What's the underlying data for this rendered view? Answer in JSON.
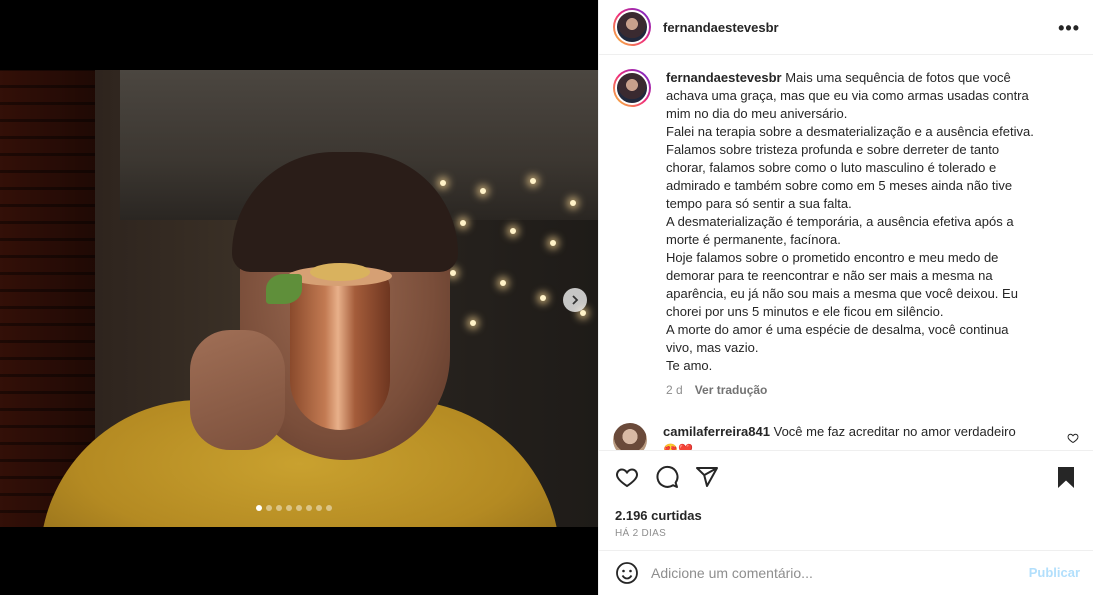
{
  "post": {
    "username": "fernandaestevesbr",
    "more_icon": "ellipsis-icon",
    "carousel": {
      "count": 8,
      "active_index": 0
    }
  },
  "caption": {
    "username": "fernandaestevesbr",
    "lines": [
      "Mais uma sequência de fotos que você achava uma graça, mas que eu via como armas usadas contra mim no dia do meu aniversário.",
      "Falei na terapia sobre a desmaterialização e a ausência efetiva.",
      "Falamos sobre tristeza profunda e sobre derreter de tanto chorar, falamos sobre como o luto masculino é tolerado e admirado e também sobre como em 5 meses ainda não tive tempo para só sentir a sua falta.",
      "A desmaterialização é temporária, a ausência efetiva após a morte é permanente, facínora.",
      "Hoje falamos sobre o prometido encontro e meu medo de demorar para te reencontrar e não ser mais a mesma na aparência, eu já não sou mais a mesma que você deixou. Eu chorei por uns 5 minutos e ele ficou em silêncio.",
      "A morte do amor é uma espécie de desalma, você continua vivo, mas vazio.",
      "Te amo."
    ],
    "time_ago": "2 d",
    "translate": "Ver tradução"
  },
  "comment": {
    "username": "camilaferreira841",
    "text": "Você me faz acreditar no amor verdadeiro",
    "emojis": "😍❤️"
  },
  "actions": {
    "likes": "2.196 curtidas",
    "date": "HÁ 2 DIAS"
  },
  "add_comment": {
    "placeholder": "Adicione um comentário...",
    "publish": "Publicar"
  }
}
